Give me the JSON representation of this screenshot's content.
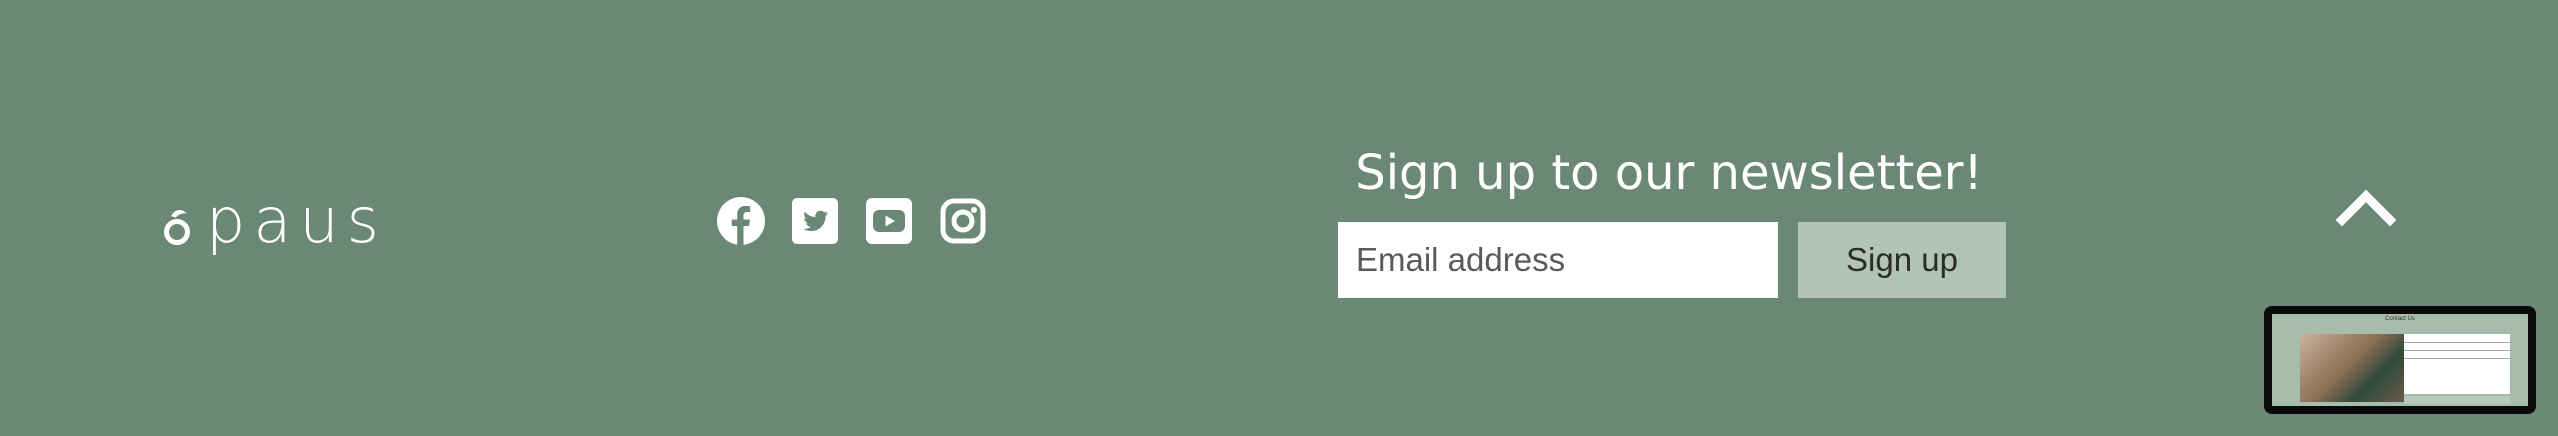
{
  "logo": {
    "text": "paus",
    "icon": "logo-mark-icon"
  },
  "social": {
    "items": [
      {
        "name": "facebook",
        "icon": "facebook-icon"
      },
      {
        "name": "twitter",
        "icon": "twitter-icon"
      },
      {
        "name": "youtube",
        "icon": "youtube-icon"
      },
      {
        "name": "instagram",
        "icon": "instagram-icon"
      }
    ]
  },
  "newsletter": {
    "title": "Sign up to our newsletter!",
    "email_placeholder": "Email address",
    "email_value": "",
    "button_label": "Sign up"
  },
  "scroll_top": {
    "icon": "chevron-up-icon"
  },
  "thumbnail": {
    "title": "Contact Us"
  },
  "colors": {
    "footer_bg": "#6b8775",
    "button_bg": "#b2c3b7",
    "text_light": "#ffffff",
    "input_bg": "#ffffff"
  }
}
